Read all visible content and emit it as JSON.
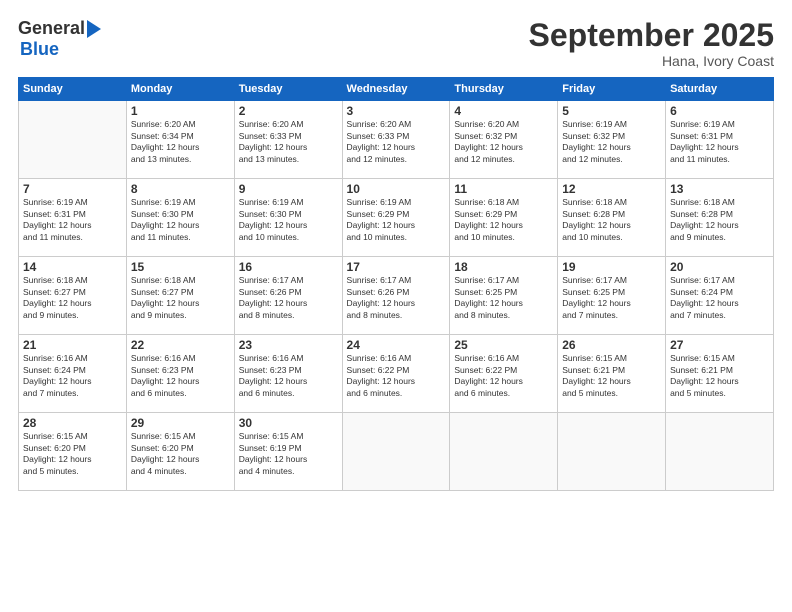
{
  "header": {
    "logo_general": "General",
    "logo_blue": "Blue",
    "month_title": "September 2025",
    "subtitle": "Hana, Ivory Coast"
  },
  "days_of_week": [
    "Sunday",
    "Monday",
    "Tuesday",
    "Wednesday",
    "Thursday",
    "Friday",
    "Saturday"
  ],
  "weeks": [
    [
      {
        "day": "",
        "info": ""
      },
      {
        "day": "1",
        "info": "Sunrise: 6:20 AM\nSunset: 6:34 PM\nDaylight: 12 hours\nand 13 minutes."
      },
      {
        "day": "2",
        "info": "Sunrise: 6:20 AM\nSunset: 6:33 PM\nDaylight: 12 hours\nand 13 minutes."
      },
      {
        "day": "3",
        "info": "Sunrise: 6:20 AM\nSunset: 6:33 PM\nDaylight: 12 hours\nand 12 minutes."
      },
      {
        "day": "4",
        "info": "Sunrise: 6:20 AM\nSunset: 6:32 PM\nDaylight: 12 hours\nand 12 minutes."
      },
      {
        "day": "5",
        "info": "Sunrise: 6:19 AM\nSunset: 6:32 PM\nDaylight: 12 hours\nand 12 minutes."
      },
      {
        "day": "6",
        "info": "Sunrise: 6:19 AM\nSunset: 6:31 PM\nDaylight: 12 hours\nand 11 minutes."
      }
    ],
    [
      {
        "day": "7",
        "info": "Sunrise: 6:19 AM\nSunset: 6:31 PM\nDaylight: 12 hours\nand 11 minutes."
      },
      {
        "day": "8",
        "info": "Sunrise: 6:19 AM\nSunset: 6:30 PM\nDaylight: 12 hours\nand 11 minutes."
      },
      {
        "day": "9",
        "info": "Sunrise: 6:19 AM\nSunset: 6:30 PM\nDaylight: 12 hours\nand 10 minutes."
      },
      {
        "day": "10",
        "info": "Sunrise: 6:19 AM\nSunset: 6:29 PM\nDaylight: 12 hours\nand 10 minutes."
      },
      {
        "day": "11",
        "info": "Sunrise: 6:18 AM\nSunset: 6:29 PM\nDaylight: 12 hours\nand 10 minutes."
      },
      {
        "day": "12",
        "info": "Sunrise: 6:18 AM\nSunset: 6:28 PM\nDaylight: 12 hours\nand 10 minutes."
      },
      {
        "day": "13",
        "info": "Sunrise: 6:18 AM\nSunset: 6:28 PM\nDaylight: 12 hours\nand 9 minutes."
      }
    ],
    [
      {
        "day": "14",
        "info": "Sunrise: 6:18 AM\nSunset: 6:27 PM\nDaylight: 12 hours\nand 9 minutes."
      },
      {
        "day": "15",
        "info": "Sunrise: 6:18 AM\nSunset: 6:27 PM\nDaylight: 12 hours\nand 9 minutes."
      },
      {
        "day": "16",
        "info": "Sunrise: 6:17 AM\nSunset: 6:26 PM\nDaylight: 12 hours\nand 8 minutes."
      },
      {
        "day": "17",
        "info": "Sunrise: 6:17 AM\nSunset: 6:26 PM\nDaylight: 12 hours\nand 8 minutes."
      },
      {
        "day": "18",
        "info": "Sunrise: 6:17 AM\nSunset: 6:25 PM\nDaylight: 12 hours\nand 8 minutes."
      },
      {
        "day": "19",
        "info": "Sunrise: 6:17 AM\nSunset: 6:25 PM\nDaylight: 12 hours\nand 7 minutes."
      },
      {
        "day": "20",
        "info": "Sunrise: 6:17 AM\nSunset: 6:24 PM\nDaylight: 12 hours\nand 7 minutes."
      }
    ],
    [
      {
        "day": "21",
        "info": "Sunrise: 6:16 AM\nSunset: 6:24 PM\nDaylight: 12 hours\nand 7 minutes."
      },
      {
        "day": "22",
        "info": "Sunrise: 6:16 AM\nSunset: 6:23 PM\nDaylight: 12 hours\nand 6 minutes."
      },
      {
        "day": "23",
        "info": "Sunrise: 6:16 AM\nSunset: 6:23 PM\nDaylight: 12 hours\nand 6 minutes."
      },
      {
        "day": "24",
        "info": "Sunrise: 6:16 AM\nSunset: 6:22 PM\nDaylight: 12 hours\nand 6 minutes."
      },
      {
        "day": "25",
        "info": "Sunrise: 6:16 AM\nSunset: 6:22 PM\nDaylight: 12 hours\nand 6 minutes."
      },
      {
        "day": "26",
        "info": "Sunrise: 6:15 AM\nSunset: 6:21 PM\nDaylight: 12 hours\nand 5 minutes."
      },
      {
        "day": "27",
        "info": "Sunrise: 6:15 AM\nSunset: 6:21 PM\nDaylight: 12 hours\nand 5 minutes."
      }
    ],
    [
      {
        "day": "28",
        "info": "Sunrise: 6:15 AM\nSunset: 6:20 PM\nDaylight: 12 hours\nand 5 minutes."
      },
      {
        "day": "29",
        "info": "Sunrise: 6:15 AM\nSunset: 6:20 PM\nDaylight: 12 hours\nand 4 minutes."
      },
      {
        "day": "30",
        "info": "Sunrise: 6:15 AM\nSunset: 6:19 PM\nDaylight: 12 hours\nand 4 minutes."
      },
      {
        "day": "",
        "info": ""
      },
      {
        "day": "",
        "info": ""
      },
      {
        "day": "",
        "info": ""
      },
      {
        "day": "",
        "info": ""
      }
    ]
  ]
}
